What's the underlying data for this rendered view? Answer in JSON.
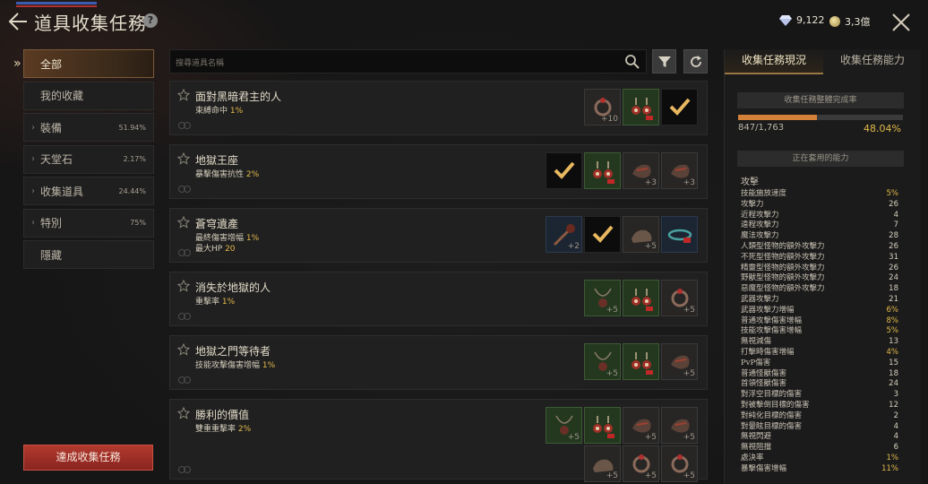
{
  "header": {
    "title": "道具收集任務",
    "help": "?",
    "diamond_value": "9,122",
    "gold_value": "3,3億"
  },
  "sidebar": {
    "items": [
      {
        "label": "全部",
        "active": true,
        "pct": ""
      },
      {
        "label": "我的收藏",
        "active": false,
        "pct": ""
      },
      {
        "label": "裝備",
        "active": false,
        "pct": "51.94%"
      },
      {
        "label": "天堂石",
        "active": false,
        "pct": "2.17%"
      },
      {
        "label": "收集道具",
        "active": false,
        "pct": "24.44%"
      },
      {
        "label": "特別",
        "active": false,
        "pct": "75%"
      },
      {
        "label": "隱藏",
        "active": false,
        "pct": ""
      }
    ],
    "complete_button": "達成收集任務"
  },
  "search": {
    "placeholder": "搜尋道具名稱"
  },
  "quests": [
    {
      "name": "面對黑暗君主的人",
      "stats": [
        {
          "label": "束縛命中",
          "value": "1%"
        }
      ],
      "slots": [
        {
          "type": "dark",
          "art": "ring",
          "count": "+10"
        },
        {
          "type": "green",
          "art": "earring",
          "count": ""
        },
        {
          "type": "black",
          "check": true,
          "count": ""
        }
      ]
    },
    {
      "name": "地獄王座",
      "stats": [
        {
          "label": "暴擊傷害抗性",
          "value": "2%"
        }
      ],
      "slots": [
        {
          "type": "black",
          "check": true,
          "count": ""
        },
        {
          "type": "green",
          "art": "earring",
          "count": ""
        },
        {
          "type": "dark",
          "art": "gauntlet",
          "count": "+3"
        },
        {
          "type": "dark",
          "art": "gauntlet",
          "count": "+3"
        }
      ]
    },
    {
      "name": "蒼穹遺產",
      "stats": [
        {
          "label": "最終傷害增幅",
          "value": "1%"
        },
        {
          "label": "最大HP",
          "value": "20"
        }
      ],
      "slots": [
        {
          "type": "blue",
          "art": "weapon",
          "count": "+2"
        },
        {
          "type": "black",
          "check": true,
          "count": ""
        },
        {
          "type": "dark",
          "art": "boots",
          "count": "+5"
        },
        {
          "type": "blue",
          "art": "belt",
          "count": ""
        }
      ]
    },
    {
      "name": "消失於地獄的人",
      "stats": [
        {
          "label": "重擊率",
          "value": "1%"
        }
      ],
      "slots": [
        {
          "type": "green",
          "art": "necklace",
          "count": "+5"
        },
        {
          "type": "green",
          "art": "earring",
          "count": ""
        },
        {
          "type": "dark",
          "art": "ring",
          "count": "+5"
        }
      ]
    },
    {
      "name": "地獄之門等待者",
      "stats": [
        {
          "label": "技能攻擊傷害增幅",
          "value": "1%"
        }
      ],
      "slots": [
        {
          "type": "green",
          "art": "necklace",
          "count": "+5"
        },
        {
          "type": "green",
          "art": "earring",
          "count": ""
        },
        {
          "type": "dark",
          "art": "gauntlet",
          "count": "+5"
        }
      ]
    },
    {
      "name": "勝利的價值",
      "stats": [
        {
          "label": "雙重重擊率",
          "value": "2%"
        }
      ],
      "slots": [
        {
          "type": "green",
          "art": "necklace",
          "count": "+5"
        },
        {
          "type": "green",
          "art": "earring",
          "count": ""
        },
        {
          "type": "dark",
          "art": "gauntlet",
          "count": "+5"
        },
        {
          "type": "dark",
          "art": "gauntlet",
          "count": "+5"
        },
        {
          "type": "dark",
          "art": "boots",
          "count": "+5"
        },
        {
          "type": "dark",
          "art": "ring",
          "count": "+5"
        },
        {
          "type": "dark",
          "art": "ring",
          "count": "+5"
        }
      ]
    }
  ],
  "right_panel": {
    "tabs": [
      "收集任務現況",
      "收集任務能力"
    ],
    "overall_label": "收集任務整體完成率",
    "progress_count": "847/1,763",
    "progress_pct": "48.04%",
    "progress_fraction": 0.4804,
    "active_abilities_label": "正在套用的能力",
    "section": "攻擊",
    "stats": [
      {
        "label": "技能施放速度",
        "value": "5%"
      },
      {
        "label": "攻擊力",
        "value": "26"
      },
      {
        "label": "近程攻擊力",
        "value": "4"
      },
      {
        "label": "遠程攻擊力",
        "value": "7"
      },
      {
        "label": "魔法攻擊力",
        "value": "28"
      },
      {
        "label": "人類型怪物的額外攻擊力",
        "value": "26"
      },
      {
        "label": "不死型怪物的額外攻擊力",
        "value": "31"
      },
      {
        "label": "精靈型怪物的額外攻擊力",
        "value": "26"
      },
      {
        "label": "野獸型怪物的額外攻擊力",
        "value": "24"
      },
      {
        "label": "惡魔型怪物的額外攻擊力",
        "value": "18"
      },
      {
        "label": "武器攻擊力",
        "value": "21"
      },
      {
        "label": "武器攻擊力增幅",
        "value": "6%"
      },
      {
        "label": "普通攻擊傷害增幅",
        "value": "8%"
      },
      {
        "label": "技能攻擊傷害增幅",
        "value": "5%"
      },
      {
        "label": "無視減傷",
        "value": "13"
      },
      {
        "label": "打擊時傷害增幅",
        "value": "4%"
      },
      {
        "label": "PvP傷害",
        "value": "15"
      },
      {
        "label": "普通怪獸傷害",
        "value": "18"
      },
      {
        "label": "首領怪獸傷害",
        "value": "24"
      },
      {
        "label": "對浮空目標的傷害",
        "value": "3"
      },
      {
        "label": "對被擊倒目標的傷害",
        "value": "12"
      },
      {
        "label": "對純化目標的傷害",
        "value": "2"
      },
      {
        "label": "對暈眩目標的傷害",
        "value": "4"
      },
      {
        "label": "無視閃避",
        "value": "4"
      },
      {
        "label": "無視阻擋",
        "value": "6"
      },
      {
        "label": "處決率",
        "value": "1%"
      },
      {
        "label": "暴擊傷害增幅",
        "value": "11%"
      }
    ]
  }
}
